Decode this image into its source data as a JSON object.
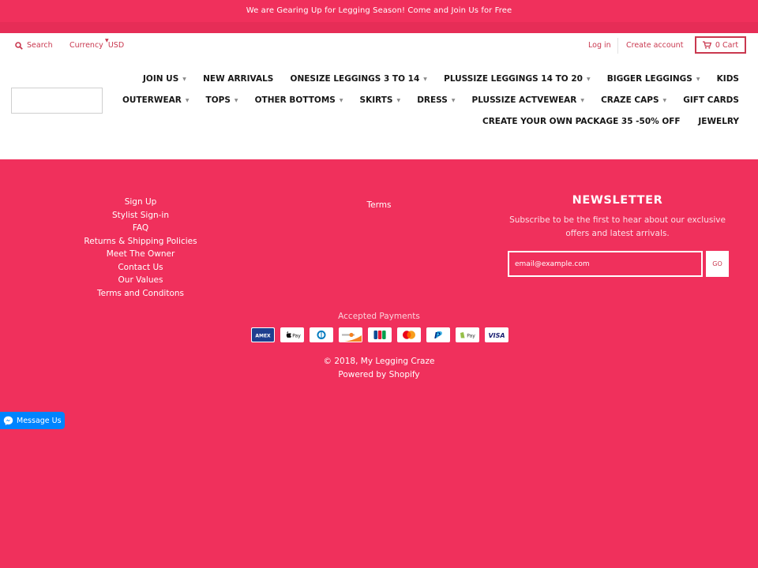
{
  "announcement": {
    "text": "We are Gearing Up for Legging Season! Come and Join Us for Free"
  },
  "header": {
    "search_label": "Search",
    "currency_label": "Currency",
    "currency_value": "USD",
    "login_label": "Log in",
    "create_account_label": "Create account",
    "cart_label": "0 Cart"
  },
  "nav": {
    "row1": [
      {
        "label": "JOIN US",
        "dropdown": true
      },
      {
        "label": "NEW ARRIVALS",
        "dropdown": false
      },
      {
        "label": "ONESIZE LEGGINGS 3 TO 14",
        "dropdown": true
      },
      {
        "label": "PLUSSIZE LEGGINGS 14 TO 20",
        "dropdown": true
      },
      {
        "label": "BIGGER LEGGINGS",
        "dropdown": true
      },
      {
        "label": "KIDS",
        "dropdown": false
      }
    ],
    "row2": [
      {
        "label": "OUTERWEAR",
        "dropdown": true
      },
      {
        "label": "TOPS",
        "dropdown": true
      },
      {
        "label": "OTHER BOTTOMS",
        "dropdown": true
      },
      {
        "label": "SKIRTS",
        "dropdown": true
      },
      {
        "label": "DRESS",
        "dropdown": true
      },
      {
        "label": "PLUSSIZE ACTVEWEAR",
        "dropdown": true
      },
      {
        "label": "CRAZE CAPS",
        "dropdown": true
      },
      {
        "label": "GIFT CARDS",
        "dropdown": false
      }
    ],
    "row3": [
      {
        "label": "CREATE YOUR OWN PACKAGE 35 -50% OFF",
        "dropdown": false
      },
      {
        "label": "JEWELRY",
        "dropdown": false
      }
    ]
  },
  "footer": {
    "links": [
      "Sign Up",
      "Stylist Sign-in",
      "FAQ",
      "Returns & Shipping Policies",
      "Meet The Owner",
      "Contact Us",
      "Our Values",
      "Terms and Conditons"
    ],
    "terms_link": "Terms",
    "newsletter": {
      "title": "NEWSLETTER",
      "description": "Subscribe to be the first to hear about our exclusive offers and latest arrivals.",
      "email_placeholder": "email@example.com",
      "submit_label": "GO"
    },
    "accepted_payments_label": "Accepted Payments",
    "payment_methods": [
      {
        "name": "amex-icon",
        "text": "AMEX"
      },
      {
        "name": "apple-pay-icon",
        "text": "Pay"
      },
      {
        "name": "diners-club-icon",
        "text": ""
      },
      {
        "name": "discover-icon",
        "text": ""
      },
      {
        "name": "jcb-icon",
        "text": ""
      },
      {
        "name": "mastercard-icon",
        "text": ""
      },
      {
        "name": "paypal-icon",
        "text": "P"
      },
      {
        "name": "shopify-pay-icon",
        "text": "Pay"
      },
      {
        "name": "visa-icon",
        "text": "VISA"
      }
    ],
    "copyright": "© 2018, My Legging Craze",
    "powered_by": "Powered by Shopify"
  },
  "messenger": {
    "label": "Message Us"
  },
  "colors": {
    "brand": "#f0305c",
    "accent_text": "#c9384f",
    "messenger": "#0084ff"
  }
}
